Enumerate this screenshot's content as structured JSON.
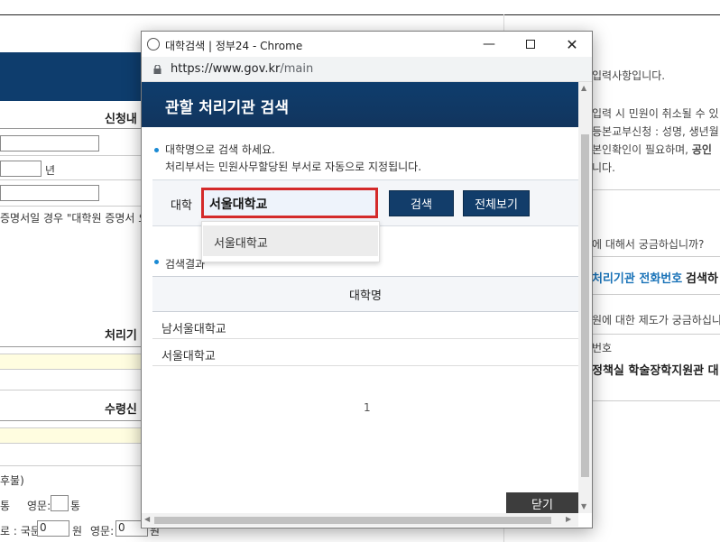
{
  "background": {
    "left": {
      "section1_title": "신청내",
      "year_suffix": "년",
      "note_text": "증명서일 경우 \"대학원 증명서 요",
      "section2_title": "처리기",
      "section3_title": "수령신",
      "paren_text": "후불)",
      "row1_a": "통",
      "row1_b": "영문:",
      "row1_c": "통",
      "row2_a": "로 : 국문:",
      "row2_val1": "0",
      "row2_b": "원",
      "row2_c": "영문:",
      "row2_val2": "0",
      "row2_d": "원"
    },
    "right": {
      "line1": "입력사항입니다.",
      "line2": "입력 시 민원이 취소될 수 있",
      "line3": "등본교부신청 : 성명, 생년월",
      "line4a": "본인확인이 필요하며, ",
      "line4b": "공인",
      "line5": "니다.",
      "line6": "에 대해서 궁금하십니까?",
      "line7a": "처리기관 전화번호",
      "line7b": "검색하",
      "line8": "원에 대한 제도가 궁금하십니",
      "line9": "번호",
      "line10": "정책실 학술장학지원관 대"
    }
  },
  "popup": {
    "window_title": "대학검색 | 정부24 - Chrome",
    "url_host": "https://www.gov.kr",
    "url_path": "/main",
    "header_title": "관할 처리기관 검색",
    "intro_line1": "대학명으로 검색 하세요.",
    "intro_line2": "처리부서는 민원사무할당된 부서로 자동으로 지정됩니다.",
    "search": {
      "label": "대학",
      "value": "서울대학교",
      "search_button": "검색",
      "view_all_button": "전체보기"
    },
    "autocomplete": [
      "서울대학교"
    ],
    "results_label": "검색결과",
    "table": {
      "header": "대학명",
      "rows": [
        "남서울대학교",
        "서울대학교"
      ]
    },
    "page_number": "1",
    "close_button": "닫기"
  }
}
